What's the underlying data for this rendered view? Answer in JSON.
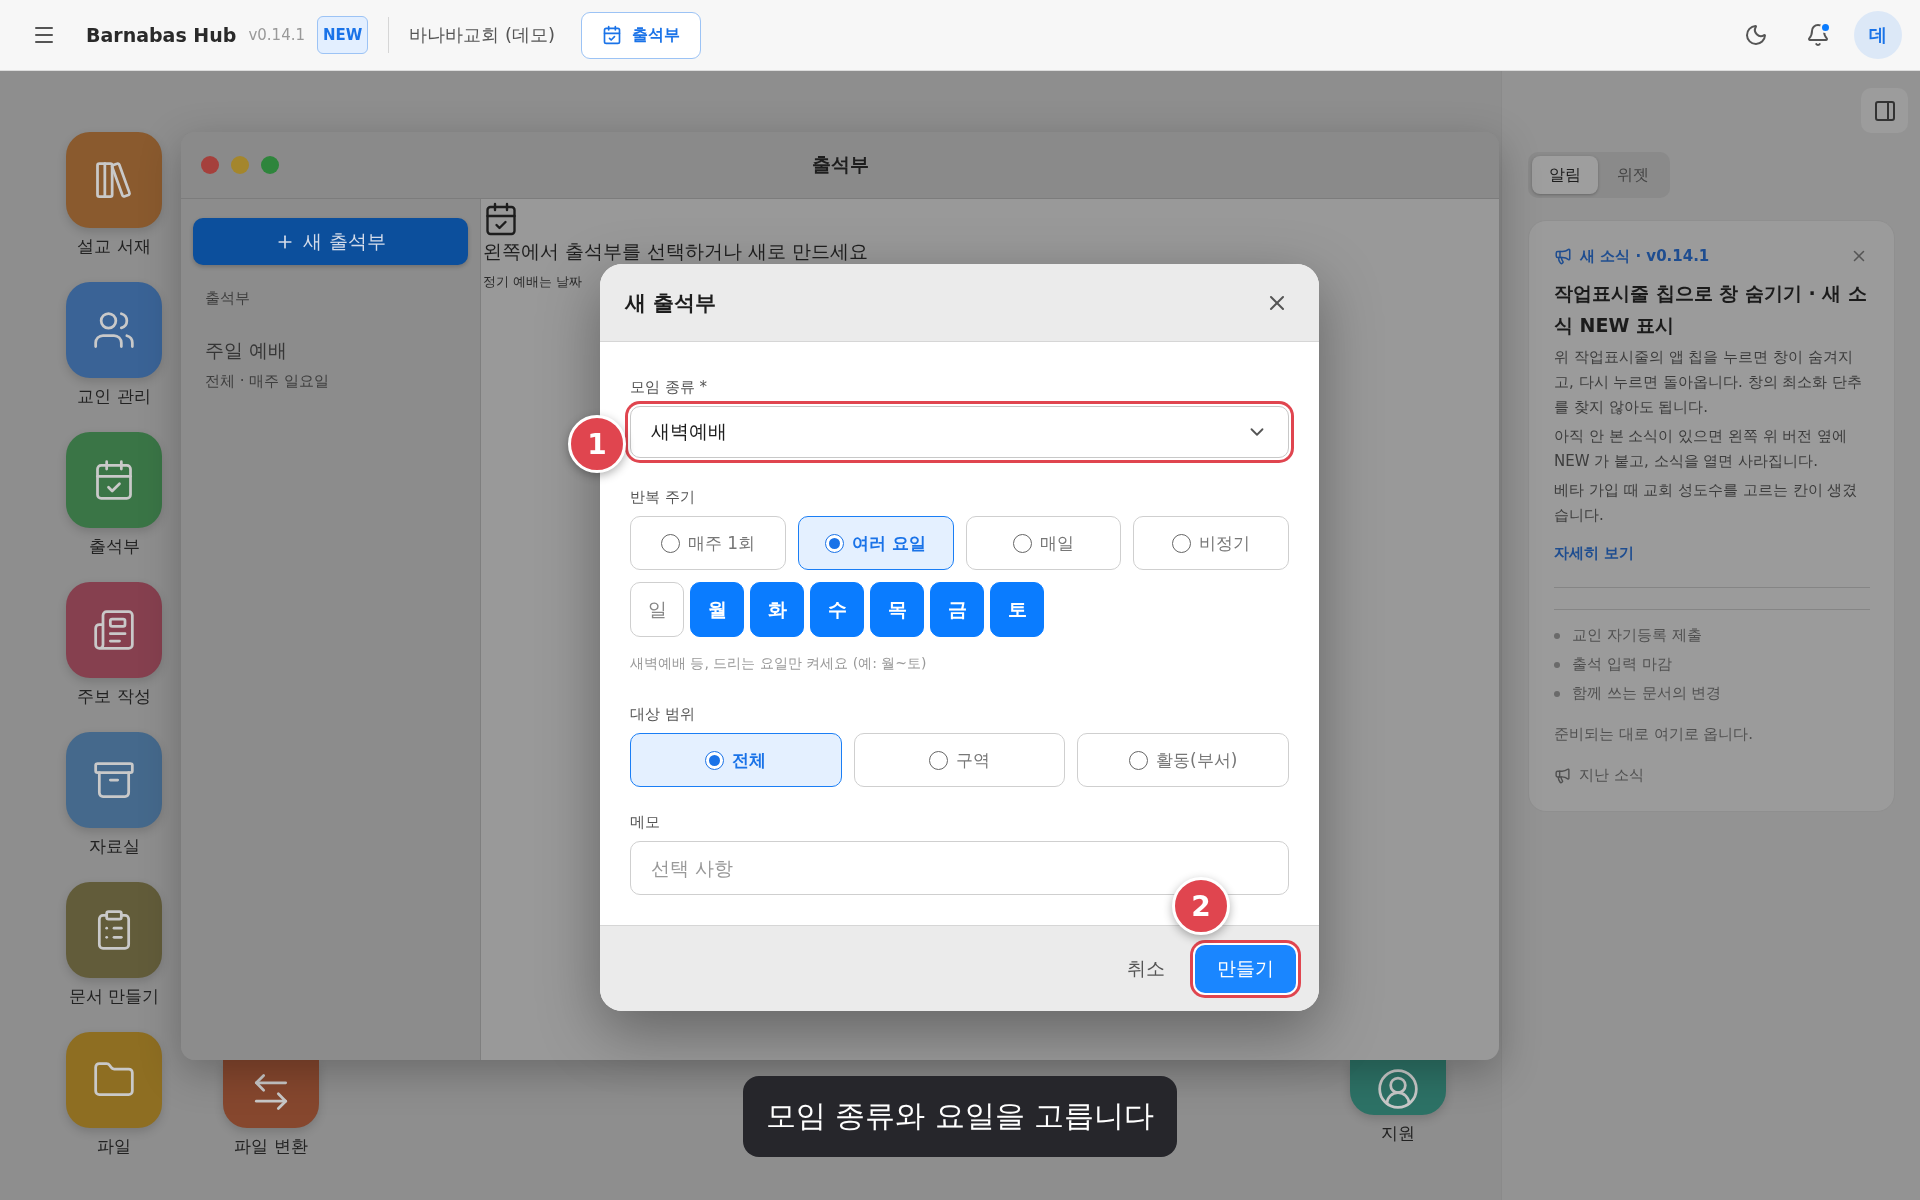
{
  "top_bar": {
    "app_name": "Barnabas Hub",
    "version": "v0.14.1",
    "new_badge": "NEW",
    "church": "바나바교회 (데모)",
    "active_app": "출석부",
    "notification_unread": true,
    "avatar": "데"
  },
  "dock": [
    {
      "label": "설교 서재",
      "color": "#8a5a2e"
    },
    {
      "label": "교인 관리",
      "color": "#3a6396"
    },
    {
      "label": "출석부",
      "color": "#3a7546"
    },
    {
      "label": "주보 작성",
      "color": "#86404f"
    },
    {
      "label": "자료실",
      "color": "#45698c"
    },
    {
      "label": "문서 만들기",
      "color": "#625c3a"
    },
    {
      "label": "파일",
      "color": "#8e6e22"
    }
  ],
  "desktop_icons": [
    {
      "label": "파일 변환",
      "color": "#86472e"
    },
    {
      "label": "지원",
      "color": "#2d7266"
    }
  ],
  "window": {
    "title": "출석부",
    "new_button": "새 출석부",
    "section": "출석부",
    "items": [
      {
        "name": "주일 예배",
        "detail": "전체 · 매주 일요일"
      }
    ],
    "empty_heading": "왼쪽에서 출석부를 선택하거나 새로 만드세요",
    "empty_text": "정기 예배는 날짜"
  },
  "dialog": {
    "title": "새 출석부",
    "meeting_type": {
      "label": "모임 종류 *",
      "value": "새벽예배",
      "step": "1"
    },
    "repeat": {
      "label": "반복 주기",
      "options": [
        {
          "label": "매주 1회",
          "selected": false
        },
        {
          "label": "여러 요일",
          "selected": true
        },
        {
          "label": "매일",
          "selected": false
        },
        {
          "label": "비정기",
          "selected": false
        }
      ]
    },
    "days": [
      {
        "label": "일",
        "on": false
      },
      {
        "label": "월",
        "on": true
      },
      {
        "label": "화",
        "on": true
      },
      {
        "label": "수",
        "on": true
      },
      {
        "label": "목",
        "on": true
      },
      {
        "label": "금",
        "on": true
      },
      {
        "label": "토",
        "on": true
      }
    ],
    "days_hint": "새벽예배 등, 드리는 요일만 켜세요 (예: 월~토)",
    "scope": {
      "label": "대상 범위",
      "options": [
        {
          "label": "전체",
          "selected": true
        },
        {
          "label": "구역",
          "selected": false
        },
        {
          "label": "활동(부서)",
          "selected": false
        }
      ]
    },
    "memo": {
      "label": "메모",
      "placeholder": "선택 사항"
    },
    "cancel": "취소",
    "create": {
      "label": "만들기",
      "step": "2"
    }
  },
  "toast": "모임 종류와 요일을 고릅니다",
  "side_panel": {
    "tabs": [
      {
        "label": "알림",
        "selected": true
      },
      {
        "label": "위젯",
        "selected": false
      }
    ],
    "news": {
      "tag": "새 소식 · v0.14.1",
      "title": "작업표시줄 칩으로 창 숨기기 · 새 소식 NEW 표시",
      "paragraphs": [
        "위 작업표시줄의 앱 칩을 누르면 창이 숨겨지고, 다시 누르면 돌아옵니다. 창의 최소화 단추를 찾지 않아도 됩니다.",
        "아직 안 본 소식이 있으면 왼쪽 위 버전 옆에 NEW 가 붙고, 소식을 열면 사라집니다.",
        "베타 가입 때 교회 성도수를 고르는 칸이 생겼습니다."
      ],
      "link": "자세히 보기",
      "upcoming": [
        "교인 자기등록 제출",
        "출석 입력 마감",
        "함께 쓰는 문서의 변경"
      ],
      "note": "준비되는 대로 여기로 옵니다.",
      "past_link": "지난 소식"
    }
  }
}
